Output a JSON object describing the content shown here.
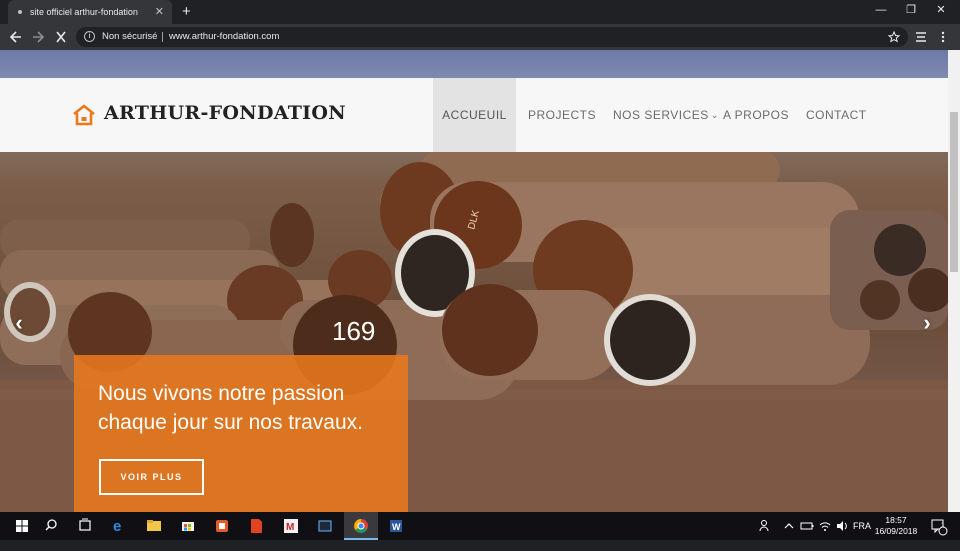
{
  "browser": {
    "tab_title": "site officiel arthur-fondation",
    "tab_close": "✕",
    "new_tab": "+",
    "security_label": "Non sécurisé",
    "url": "www.arthur-fondation.com",
    "window_controls": {
      "minimize": "—",
      "restore": "❐",
      "close": "✕"
    }
  },
  "site": {
    "brand": "ARTHUR-FONDATION",
    "accent_color": "#E8791C",
    "nav": [
      {
        "label": "ACCUEUIL",
        "active": true
      },
      {
        "label": "PROJECTS",
        "active": false
      },
      {
        "label": "NOS SERVICES",
        "active": false,
        "has_dropdown": true
      },
      {
        "label": "A PROPOS",
        "active": false
      },
      {
        "label": "CONTACT",
        "active": false
      }
    ],
    "hero": {
      "headline": "Nous vivons notre passion chaque jour sur nos travaux.",
      "button": "VOIR PLUS",
      "prev_arrow": "‹",
      "next_arrow": "›",
      "log_markings": [
        "169",
        "DLK"
      ]
    }
  },
  "taskbar": {
    "language": "FRA",
    "time": "18:57",
    "date": "16/09/2018",
    "notification_count": "1"
  }
}
